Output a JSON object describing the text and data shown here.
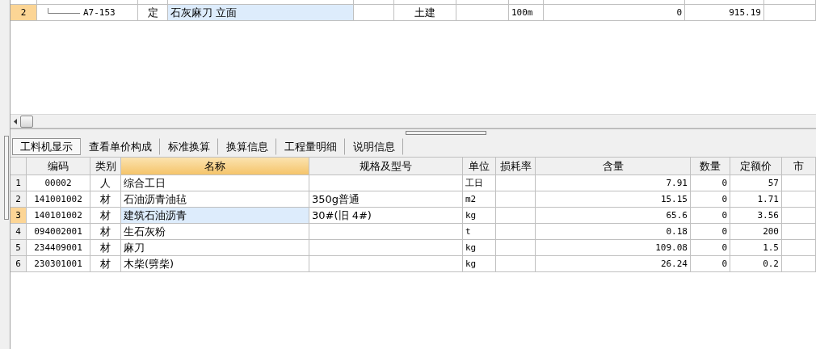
{
  "top_table": {
    "rows": [
      {
        "index": "2",
        "selected": true,
        "code": "A7-153",
        "type": "定",
        "name": "石灰麻刀 立面",
        "column_5": "",
        "column_6": "土建",
        "column_7": "",
        "unit": "100m",
        "column_9": "0",
        "column_10": "915.19"
      }
    ]
  },
  "tabs": [
    {
      "label": "工料机显示",
      "selected": true
    },
    {
      "label": "查看单价构成",
      "selected": false
    },
    {
      "label": "标准换算",
      "selected": false
    },
    {
      "label": "换算信息",
      "selected": false
    },
    {
      "label": "工程量明细",
      "selected": false
    },
    {
      "label": "说明信息",
      "selected": false
    }
  ],
  "bottom_table": {
    "columns": [
      {
        "label": "编码",
        "selected": false
      },
      {
        "label": "类别",
        "selected": false
      },
      {
        "label": "名称",
        "selected": true
      },
      {
        "label": "规格及型号",
        "selected": false
      },
      {
        "label": "单位",
        "selected": false
      },
      {
        "label": "损耗率",
        "selected": false
      },
      {
        "label": "含量",
        "selected": false
      },
      {
        "label": "数量",
        "selected": false
      },
      {
        "label": "定额价",
        "selected": false
      },
      {
        "label": "市",
        "selected": false
      }
    ],
    "rows": [
      {
        "index": "1",
        "selected": false,
        "cells": [
          "00002",
          "人",
          "综合工日",
          "",
          "工日",
          "",
          "7.91",
          "0",
          "57",
          ""
        ]
      },
      {
        "index": "2",
        "selected": false,
        "cells": [
          "141001002",
          "材",
          "石油沥青油毡",
          "350g普通",
          "m2",
          "",
          "15.15",
          "0",
          "1.71",
          ""
        ]
      },
      {
        "index": "3",
        "selected": true,
        "cells": [
          "140101002",
          "材",
          "建筑石油沥青",
          "30#(旧 4#)",
          "kg",
          "",
          "65.6",
          "0",
          "3.56",
          ""
        ]
      },
      {
        "index": "4",
        "selected": false,
        "cells": [
          "094002001",
          "材",
          "生石灰粉",
          "",
          "t",
          "",
          "0.18",
          "0",
          "200",
          ""
        ]
      },
      {
        "index": "5",
        "selected": false,
        "cells": [
          "234409001",
          "材",
          "麻刀",
          "",
          "kg",
          "",
          "109.08",
          "0",
          "1.5",
          ""
        ]
      },
      {
        "index": "6",
        "selected": false,
        "cells": [
          "230301001",
          "材",
          "木柴(劈柴)",
          "",
          "kg",
          "",
          "26.24",
          "0",
          "0.2",
          ""
        ]
      }
    ]
  }
}
